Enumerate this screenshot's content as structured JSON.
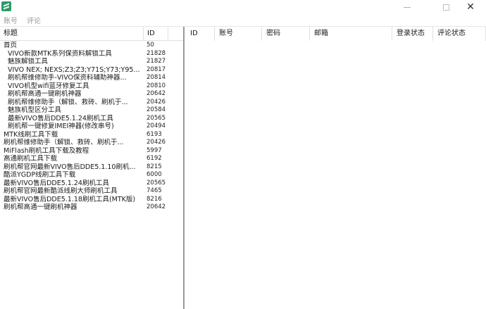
{
  "menu": {
    "account": "账号",
    "comment": "评论"
  },
  "window": {
    "close_glyph": "✕"
  },
  "list": {
    "columns": {
      "title": "标题",
      "id": "ID"
    },
    "rows": [
      {
        "title": "首页",
        "id": "50",
        "indent": false
      },
      {
        "title": "VIVO新款MTK系列保资料解锁工具",
        "id": "21828",
        "indent": true
      },
      {
        "title": "魅族解锁工具",
        "id": "21827",
        "indent": true
      },
      {
        "title": "VIVO NEX; NEXS;Z3;Z3;Y71S;Y73;Y95...",
        "id": "20817",
        "indent": true
      },
      {
        "title": "刷机帮维修助手-VIVO保资料辅助神器...",
        "id": "20814",
        "indent": true
      },
      {
        "title": "VIVO机型wifi蓝牙修复工具",
        "id": "20810",
        "indent": true
      },
      {
        "title": "刷机帮高通一键刷机神器",
        "id": "20642",
        "indent": true
      },
      {
        "title": "刷机帮维修助手（解锁、救砖、刷机于...",
        "id": "20426",
        "indent": true
      },
      {
        "title": "魅族机型区分工具",
        "id": "20584",
        "indent": true
      },
      {
        "title": "最新VIVO售后DDE5.1.24刷机工具",
        "id": "20565",
        "indent": true
      },
      {
        "title": "刷机帮一键修复IMEI神器(修改串号)",
        "id": "20494",
        "indent": true
      },
      {
        "title": "MTK线刷工具下载",
        "id": "6193",
        "indent": false
      },
      {
        "title": "刷机帮维修助手（解锁、救砖、刷机于...",
        "id": "20426",
        "indent": false
      },
      {
        "title": "MiFlash刷机工具下载及教程",
        "id": "5997",
        "indent": false
      },
      {
        "title": "高通刷机工具下载",
        "id": "6192",
        "indent": false
      },
      {
        "title": "刷机帮官网最新VIVO售后DDE5.1.10刷机...",
        "id": "8215",
        "indent": false
      },
      {
        "title": "酷派YGDP线刷工具下载",
        "id": "6000",
        "indent": false
      },
      {
        "title": "最新VIVO售后DDE5.1.24刷机工具",
        "id": "20565",
        "indent": false
      },
      {
        "title": "刷机帮官网最新酷派线刷大师刷机工具",
        "id": "7465",
        "indent": false
      },
      {
        "title": "最新VIVO售后DDE5.1.18刷机工具(MTK版)",
        "id": "8216",
        "indent": false
      },
      {
        "title": "刷机帮高通一键刷机神器",
        "id": "20642",
        "indent": false
      }
    ]
  },
  "table": {
    "columns": {
      "id": "ID",
      "account": "账号",
      "password": "密码",
      "email": "邮箱",
      "login_status": "登录状态",
      "comment_status": "评论状态"
    }
  }
}
